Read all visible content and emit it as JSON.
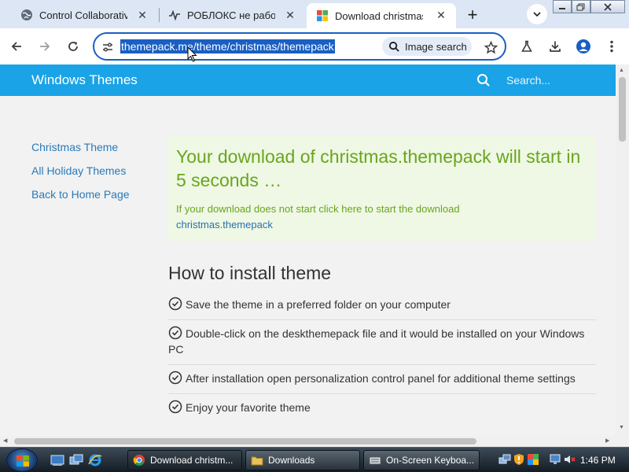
{
  "browser": {
    "tabs": [
      {
        "title": "Control Collaborative",
        "icon": "globe-icon",
        "active": false
      },
      {
        "title": "РОБЛОКС не работае",
        "icon": "pulse-icon",
        "active": false
      },
      {
        "title": "Download christmas.th",
        "icon": "windows-logo-icon",
        "active": true
      }
    ],
    "new_tab_label": "+",
    "url": "themepack.me/theme/christmas/themepack",
    "image_search_label": "Image search"
  },
  "site": {
    "title": "Windows Themes",
    "search_placeholder": "Search...",
    "sidenav": [
      {
        "label": "Christmas Theme"
      },
      {
        "label": "All Holiday Themes"
      },
      {
        "label": "Back to Home Page"
      }
    ],
    "notice": {
      "title": "Your download of christmas.themepack will start in 5 seconds …",
      "text": "If your download does not start click here to start the download",
      "link": "christmas.themepack"
    },
    "howto": {
      "title": "How to install theme",
      "steps": [
        {
          "text": "Save the theme in a preferred folder on your computer"
        },
        {
          "text": "Double-click on the deskthemepack file and it would be installed on your Windows PC"
        },
        {
          "text": "After installation open personalization control panel for additional theme settings"
        },
        {
          "text": "Enjoy your favorite theme"
        }
      ]
    }
  },
  "taskbar": {
    "buttons": [
      {
        "label": "Download christm...",
        "icon": "chrome-icon",
        "active": true
      },
      {
        "label": "Downloads",
        "icon": "folder-icon",
        "active": false
      },
      {
        "label": "On-Screen Keyboa...",
        "icon": "keyboard-icon",
        "active": false
      }
    ],
    "clock": "1:46 PM"
  },
  "colors": {
    "accent_blue": "#1a5fc2",
    "site_header": "#1aa3e6",
    "notice_green": "#6aa51e",
    "notice_bg": "#eef8e4",
    "link_blue": "#2a7ab8"
  }
}
